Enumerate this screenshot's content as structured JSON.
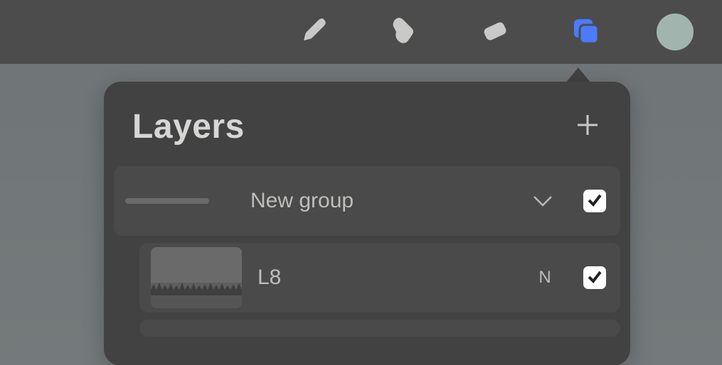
{
  "toolbar": {
    "tools": [
      {
        "name": "brush"
      },
      {
        "name": "smudge"
      },
      {
        "name": "eraser"
      },
      {
        "name": "layers",
        "active": true
      }
    ],
    "color_chip": "#a2b4ae",
    "active_color": "#4b7bff"
  },
  "panel": {
    "title": "Layers",
    "add_tooltip": "Add layer",
    "items": [
      {
        "type": "group",
        "label": "New group",
        "expanded": true,
        "visible": true
      },
      {
        "type": "layer",
        "label": "L8",
        "blend": "N",
        "visible": true
      }
    ]
  }
}
